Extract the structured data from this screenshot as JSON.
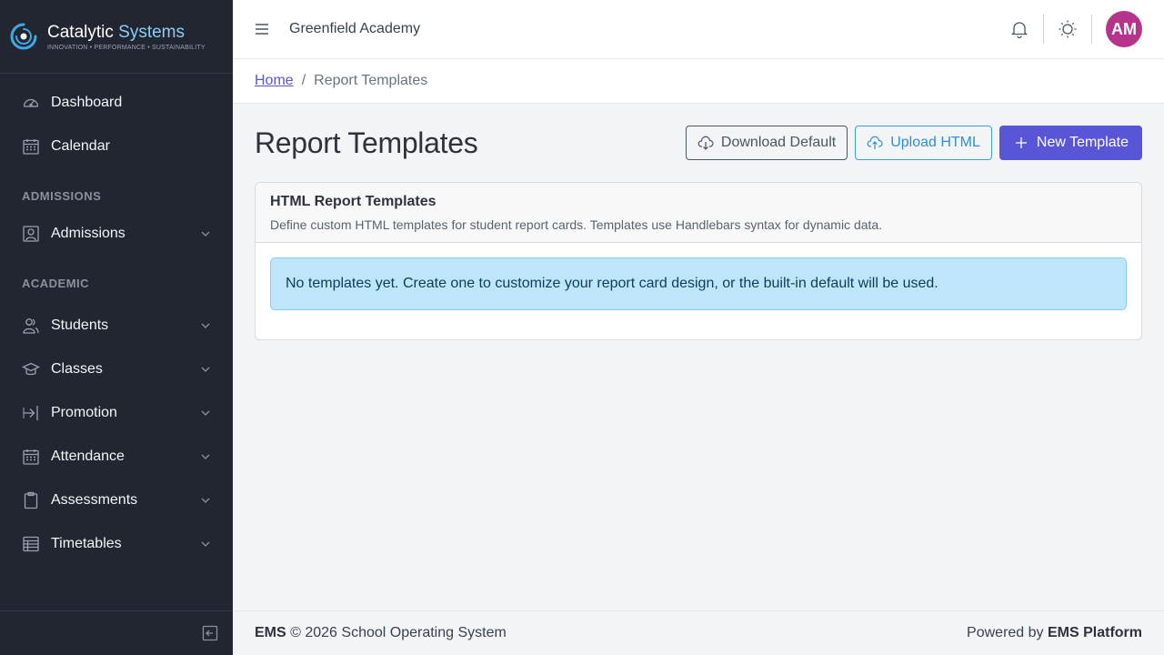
{
  "brand": {
    "name_primary": "Catalytic",
    "name_accent": "Systems",
    "tagline": "INNOVATION • PERFORMANCE • SUSTAINABILITY"
  },
  "sidebar": {
    "items_top": [
      {
        "label": "Dashboard",
        "icon": "speedometer-icon"
      },
      {
        "label": "Calendar",
        "icon": "calendar-icon"
      }
    ],
    "section_admissions": "ADMISSIONS",
    "admissions_items": [
      {
        "label": "Admissions",
        "icon": "user-card-icon"
      }
    ],
    "section_academic": "ACADEMIC",
    "academic_items": [
      {
        "label": "Students",
        "icon": "people-icon"
      },
      {
        "label": "Classes",
        "icon": "graduation-cap-icon"
      },
      {
        "label": "Promotion",
        "icon": "arrow-right-icon"
      },
      {
        "label": "Attendance",
        "icon": "calendar-grid-icon"
      },
      {
        "label": "Assessments",
        "icon": "clipboard-icon"
      },
      {
        "label": "Timetables",
        "icon": "table-icon"
      }
    ]
  },
  "header": {
    "org_name": "Greenfield Academy",
    "avatar_initials": "AM",
    "avatar_color": "#b5338a"
  },
  "breadcrumb": {
    "home": "Home",
    "separator": "/",
    "current": "Report Templates"
  },
  "page": {
    "title": "Report Templates",
    "buttons": {
      "download_default": "Download Default",
      "upload_html": "Upload HTML",
      "new_template": "New Template"
    }
  },
  "card": {
    "title": "HTML Report Templates",
    "description": "Define custom HTML templates for student report cards. Templates use Handlebars syntax for dynamic data.",
    "empty_message": "No templates yet. Create one to customize your report card design, or the built-in default will be used."
  },
  "footer": {
    "left_brand": "EMS",
    "left_text": " © 2026 School Operating System",
    "right_prefix": "Powered by ",
    "right_brand": "EMS Platform"
  },
  "colors": {
    "sidebar_bg": "#212631",
    "primary": "#5856d6",
    "info": "#3aa0dd",
    "alert_bg": "#bfe5fb"
  }
}
